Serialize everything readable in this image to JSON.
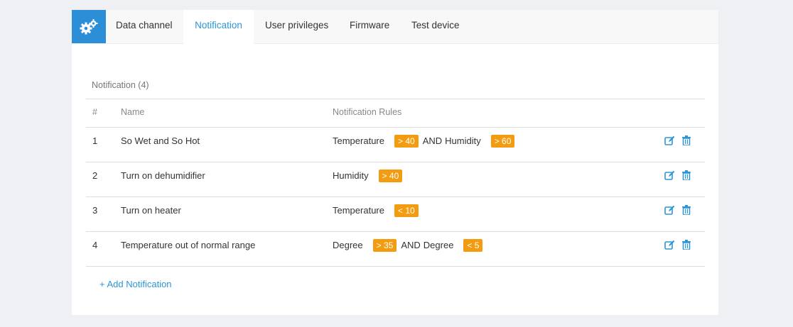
{
  "tabs": [
    {
      "label": "Data channel"
    },
    {
      "label": "Notification"
    },
    {
      "label": "User privileges"
    },
    {
      "label": "Firmware"
    },
    {
      "label": "Test device"
    }
  ],
  "section_title": "Notification (4)",
  "columns": {
    "index": "#",
    "name": "Name",
    "rules": "Notification Rules"
  },
  "rows": [
    {
      "index": "1",
      "name": "So Wet and So Hot",
      "rules": [
        {
          "field": "Temperature",
          "cond": "> 40"
        },
        {
          "join": "AND",
          "field": "Humidity",
          "cond": "> 60"
        }
      ]
    },
    {
      "index": "2",
      "name": "Turn on dehumidifier",
      "rules": [
        {
          "field": "Humidity",
          "cond": "> 40"
        }
      ]
    },
    {
      "index": "3",
      "name": "Turn on heater",
      "rules": [
        {
          "field": "Temperature",
          "cond": "< 10"
        }
      ]
    },
    {
      "index": "4",
      "name": "Temperature out of normal range",
      "rules": [
        {
          "field": "Degree",
          "cond": "> 35"
        },
        {
          "join": "AND",
          "field": "Degree",
          "cond": "< 5"
        }
      ]
    }
  ],
  "add_label": "+ Add Notification",
  "colors": {
    "accent": "#2b96d5",
    "badge": "#f39c12",
    "gear_bg": "#2b8ed6"
  },
  "icons": {
    "settings": "gears-icon",
    "edit": "edit-icon",
    "delete": "trash-icon"
  }
}
